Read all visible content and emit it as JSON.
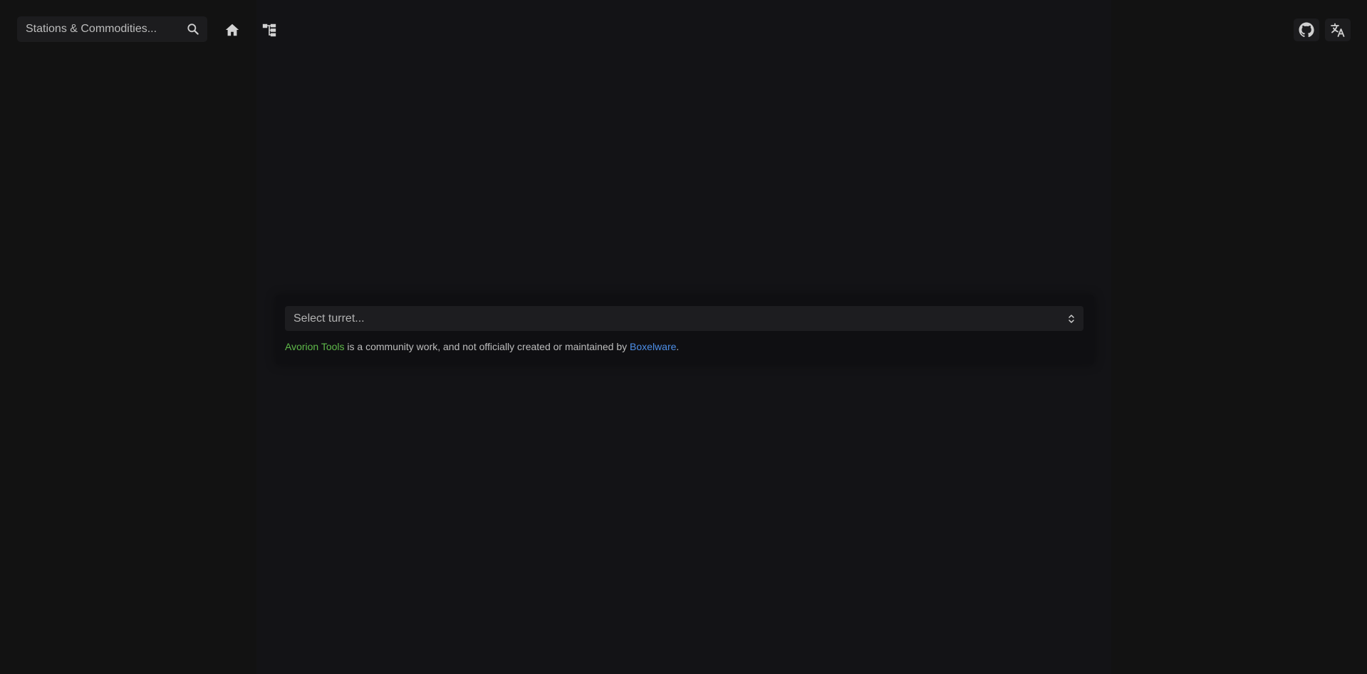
{
  "header": {
    "search": {
      "placeholder": "Stations & Commodities...",
      "icon": "search-icon"
    },
    "nav": [
      {
        "name": "home",
        "icon": "home-icon"
      },
      {
        "name": "tree",
        "icon": "tree-structure-icon"
      }
    ],
    "actions": [
      {
        "name": "github",
        "icon": "github-icon"
      },
      {
        "name": "translate",
        "icon": "translate-icon"
      }
    ]
  },
  "main": {
    "turret_select": {
      "placeholder": "Select turret..."
    },
    "disclaimer": {
      "app_name": "Avorion Tools",
      "middle_text": " is a community work, and not officially created or maintained by ",
      "company_name": "Boxelware",
      "end_text": "."
    }
  },
  "colors": {
    "background": "#121212",
    "surface": "#1c1c1e",
    "text": "#bdbdbd",
    "accent_green": "#5fba4a",
    "accent_blue": "#4d8fe8"
  }
}
